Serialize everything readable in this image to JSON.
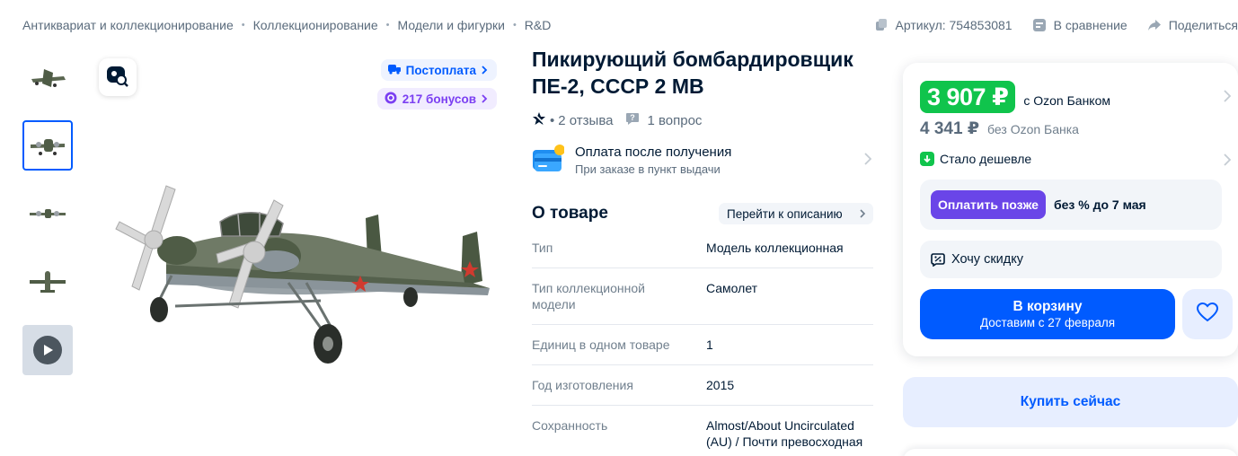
{
  "breadcrumbs": [
    "Антиквариат и коллекционирование",
    "Коллекционирование",
    "Модели и фигурки",
    "R&D"
  ],
  "meta": {
    "article_label": "Артикул: 754853081",
    "compare_label": "В сравнение",
    "share_label": "Поделиться"
  },
  "gallery": {
    "thumbnails": [
      "plane-thumb-1",
      "plane-thumb-2",
      "plane-thumb-3",
      "plane-thumb-4",
      "video-thumb"
    ],
    "active_index": 1,
    "postpay_label": "Постоплата",
    "bonus_label": "217 бонусов"
  },
  "product": {
    "title": "Пикирующий бомбардировщик ПЕ-2, СССР 2 МВ",
    "reviews_label": "2 отзыва",
    "questions_label": "1 вопрос",
    "pay_after_title": "Оплата после получения",
    "pay_after_subtitle": "При заказе в пункт выдачи"
  },
  "about": {
    "heading": "О товаре",
    "goto_label": "Перейти к описанию",
    "specs": [
      {
        "key": "Тип",
        "value": "Модель коллекционная"
      },
      {
        "key": "Тип коллекционной модели",
        "value": "Самолет"
      },
      {
        "key": "Единиц в одном товаре",
        "value": "1"
      },
      {
        "key": "Год изготовления",
        "value": "2015"
      },
      {
        "key": "Сохранность",
        "value": "Almost/About Uncirculated (AU) / Почти превосходная"
      }
    ]
  },
  "buy_card": {
    "price_card": "3 907 ₽",
    "price_card_note": "с Ozon Банком",
    "price_regular": "4 341 ₽",
    "price_regular_note": "без Ozon Банка",
    "cheaper_label": "Стало дешевле",
    "pay_later_button": "Оплатить позже",
    "pay_later_note": "без % до 7 мая",
    "discount_label": "Хочу скидку",
    "cart_button": "В корзину",
    "cart_delivery": "Доставим с 27 февраля",
    "buy_now": "Купить сейчас"
  },
  "colors": {
    "accent_blue": "#005bff",
    "price_green": "#10c44c",
    "paylater_purple": "#6a45e8",
    "bonus_purple": "#7b3ff2"
  }
}
